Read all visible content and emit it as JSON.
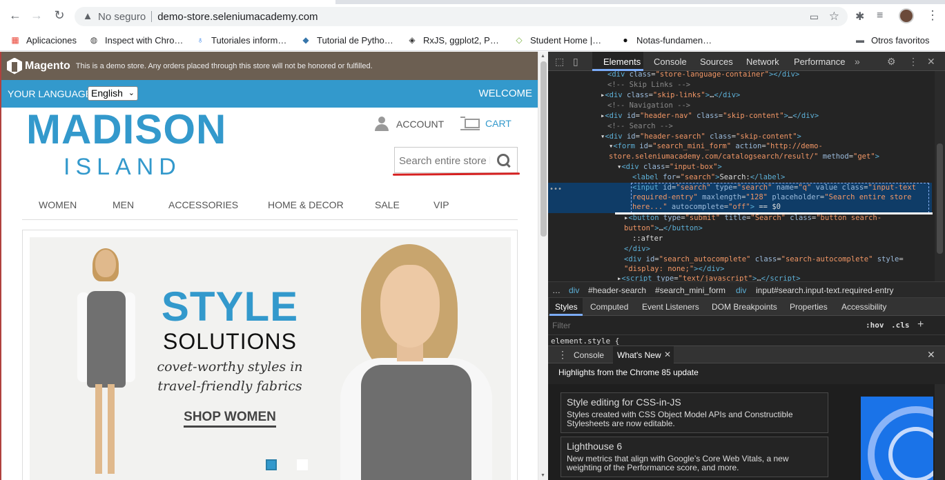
{
  "browser": {
    "address_security": "No seguro",
    "url": "demo-store.seleniumacademy.com",
    "bookmarks": [
      "Aplicaciones",
      "Inspect with Chro…",
      "Tutoriales inform…",
      "Tutorial de Pytho…",
      "RxJS, ggplot2, P…",
      "Student Home |…",
      "Notas-fundamen…"
    ],
    "other_bookmarks": "Otros favoritos"
  },
  "store": {
    "platform": "Magento",
    "demo_notice": "This is a demo store. Any orders placed through this store will not be honored or fulfilled.",
    "language_label": "YOUR LANGUAGE:",
    "language_value": "English",
    "welcome": "WELCOME",
    "brand_line1": "MADISON",
    "brand_line2": "ISLAND",
    "account": "ACCOUNT",
    "cart": "CART",
    "search_placeholder": "Search entire store here...",
    "nav": [
      "WOMEN",
      "MEN",
      "ACCESSORIES",
      "HOME & DECOR",
      "SALE",
      "VIP"
    ],
    "hero": {
      "title": "STYLE",
      "subtitle": "SOLUTIONS",
      "tagline_1": "covet-worthy styles in",
      "tagline_2": "travel-friendly fabrics",
      "cta": "SHOP WOMEN"
    },
    "brand_color": "#3399cc"
  },
  "devtools": {
    "tabs": [
      "Elements",
      "Console",
      "Sources",
      "Network",
      "Performance"
    ],
    "active_tab": "Elements",
    "breadcrumbs": [
      "…",
      "div",
      "#header-search",
      "#search_mini_form",
      "div",
      "input#search.input-text.required-entry"
    ],
    "styles_tabs": [
      "Styles",
      "Computed",
      "Event Listeners",
      "DOM Breakpoints",
      "Properties",
      "Accessibility"
    ],
    "filter_placeholder": "Filter",
    "hov": ":hov",
    "cls": ".cls",
    "element_style": "element.style {",
    "drawer_tabs": [
      "Console",
      "What's New"
    ],
    "whats_new_heading": "Highlights from the Chrome 85 update",
    "cards": [
      {
        "title": "Style editing for CSS-in-JS",
        "desc": "Styles created with CSS Object Model APIs and Constructible Stylesheets are now editable."
      },
      {
        "title": "Lighthouse 6",
        "desc": "New metrics that align with Google’s Core Web Vitals, a new weighting of the Performance score, and more."
      }
    ]
  }
}
